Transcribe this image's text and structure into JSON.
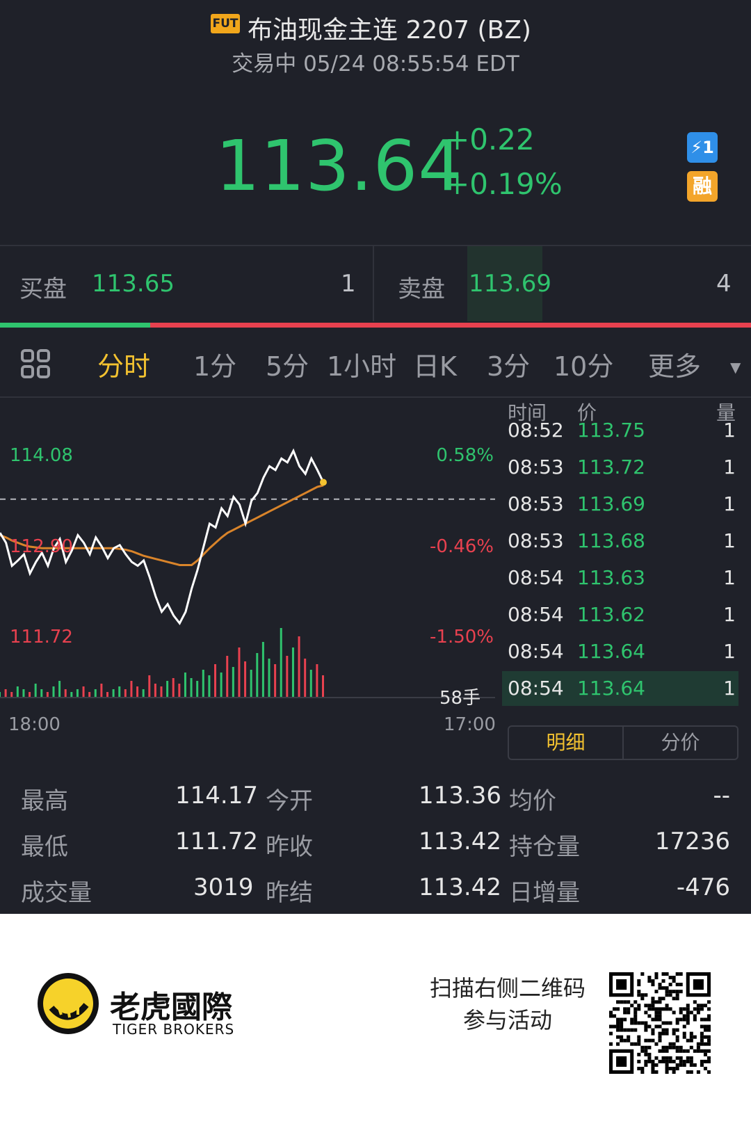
{
  "header": {
    "fut_badge": "FUT",
    "title": "布油现金主连 2207 (BZ)",
    "status": "交易中 05/24 08:55:54 EDT"
  },
  "quote": {
    "price": "113.64",
    "change": "+0.22",
    "change_pct": "+0.19%",
    "badge_flash": "⚡1",
    "badge_margin": "融"
  },
  "orderbook": {
    "bid_label": "买盘",
    "bid_price": "113.65",
    "bid_size": "1",
    "ask_label": "卖盘",
    "ask_price": "113.69",
    "ask_size": "4",
    "bid_ratio": 0.2
  },
  "tabs": {
    "items": [
      "分时",
      "1分",
      "5分",
      "1小时",
      "日K",
      "3分",
      "10分",
      "更多"
    ],
    "active": "分时"
  },
  "chart_data": {
    "type": "line",
    "y_labels": [
      "114.08",
      "112.90",
      "111.72"
    ],
    "pct_labels": [
      "0.58%",
      "-0.46%",
      "-1.50%"
    ],
    "x_labels": [
      "18:00",
      "17:00"
    ],
    "volume_label": "58手",
    "prev_close_ref": 113.42,
    "ylim": [
      111.72,
      114.08
    ],
    "price": [
      112.98,
      112.85,
      112.55,
      112.62,
      112.7,
      112.45,
      112.6,
      112.72,
      112.55,
      112.78,
      112.9,
      112.6,
      112.75,
      112.95,
      112.85,
      112.7,
      112.92,
      112.8,
      112.65,
      112.78,
      112.82,
      112.7,
      112.6,
      112.55,
      112.62,
      112.4,
      112.15,
      111.95,
      112.05,
      111.9,
      111.8,
      111.95,
      112.25,
      112.5,
      112.8,
      113.1,
      113.05,
      113.3,
      113.2,
      113.45,
      113.35,
      113.1,
      113.4,
      113.5,
      113.7,
      113.85,
      113.8,
      113.95,
      113.9,
      114.05,
      113.85,
      113.75,
      113.95,
      113.8,
      113.64
    ],
    "avg": [
      112.95,
      112.92,
      112.88,
      112.85,
      112.82,
      112.8,
      112.79,
      112.78,
      112.78,
      112.78,
      112.78,
      112.78,
      112.78,
      112.78,
      112.78,
      112.78,
      112.78,
      112.78,
      112.78,
      112.78,
      112.77,
      112.76,
      112.74,
      112.71,
      112.68,
      112.66,
      112.64,
      112.62,
      112.6,
      112.58,
      112.56,
      112.56,
      112.56,
      112.62,
      112.7,
      112.78,
      112.85,
      112.92,
      112.98,
      113.02,
      113.06,
      113.1,
      113.14,
      113.18,
      113.22,
      113.26,
      113.3,
      113.34,
      113.38,
      113.42,
      113.46,
      113.5,
      113.54,
      113.58,
      113.6
    ],
    "volume": [
      2,
      3,
      2,
      4,
      3,
      2,
      5,
      3,
      2,
      4,
      6,
      3,
      2,
      3,
      4,
      2,
      3,
      5,
      2,
      3,
      4,
      3,
      6,
      4,
      3,
      8,
      5,
      4,
      6,
      7,
      5,
      9,
      7,
      6,
      10,
      8,
      12,
      9,
      15,
      11,
      18,
      13,
      10,
      16,
      20,
      14,
      12,
      25,
      15,
      18,
      22,
      14,
      10,
      12,
      8
    ]
  },
  "trades": {
    "headers": {
      "time": "时间",
      "price": "价",
      "volume": "量"
    },
    "rows": [
      {
        "time": "08:52",
        "price": "113.75",
        "vol": "1"
      },
      {
        "time": "08:53",
        "price": "113.72",
        "vol": "1"
      },
      {
        "time": "08:53",
        "price": "113.69",
        "vol": "1"
      },
      {
        "time": "08:53",
        "price": "113.68",
        "vol": "1"
      },
      {
        "time": "08:54",
        "price": "113.63",
        "vol": "1"
      },
      {
        "time": "08:54",
        "price": "113.62",
        "vol": "1"
      },
      {
        "time": "08:54",
        "price": "113.64",
        "vol": "1"
      },
      {
        "time": "08:54",
        "price": "113.64",
        "vol": "1"
      }
    ],
    "seg_detail": "明细",
    "seg_price": "分价"
  },
  "stats": {
    "high_label": "最高",
    "high": "114.17",
    "open_label": "今开",
    "open": "113.36",
    "avg_label": "均价",
    "avg": "--",
    "low_label": "最低",
    "low": "111.72",
    "prev_close_label": "昨收",
    "prev_close": "113.42",
    "oi_label": "持仓量",
    "oi": "17236",
    "vol_label": "成交量",
    "vol": "3019",
    "prev_settle_label": "昨结",
    "prev_settle": "113.42",
    "oi_chg_label": "日增量",
    "oi_chg": "-476"
  },
  "footer": {
    "brand_cn": "老虎國際",
    "brand_en": "TIGER BROKERS",
    "promo_line1": "扫描右侧二维码",
    "promo_line2": "参与活动"
  }
}
